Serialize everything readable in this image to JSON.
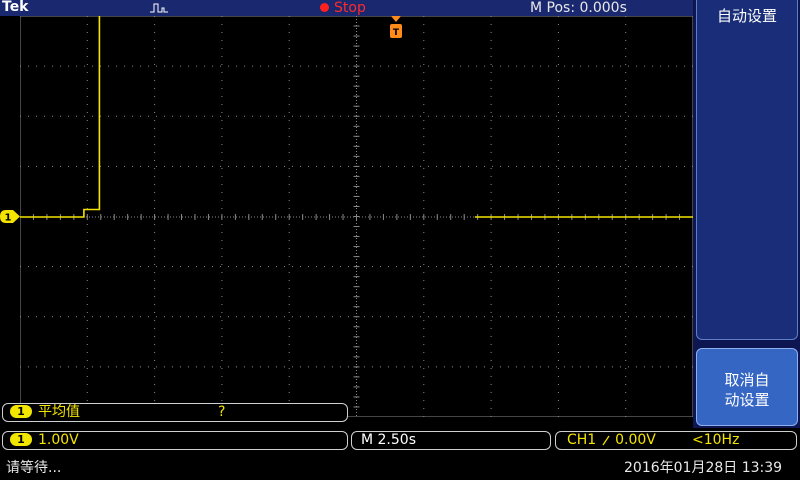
{
  "brand": "Tek",
  "acquisition": {
    "state": "Stop",
    "state_color": "#ff2020"
  },
  "horizontal_position": "M Pos: 0.000s",
  "menu": {
    "title": "自动设置",
    "undo_button_line1": "取消自",
    "undo_button_line2": "动设置"
  },
  "measurement": {
    "channel": "1",
    "label": "平均值",
    "value": "?"
  },
  "channel": {
    "number": "1",
    "scale": "1.00V",
    "color": "#f5e400"
  },
  "timebase": {
    "scale": "M 2.50s"
  },
  "trigger": {
    "source": "CH1",
    "slope_icon": "rising-edge-icon",
    "level": "0.00V",
    "frequency": "<10Hz"
  },
  "ground_marker": "1",
  "status": {
    "message": "请等待...",
    "datetime": "2016年01月28日 13:39"
  },
  "waveform": {
    "description_series": "CH1",
    "segments": [
      {
        "t_div": 0.0,
        "v_div": 0.0
      },
      {
        "t_div": 0.95,
        "v_div": 0.0
      },
      {
        "t_div": 0.95,
        "v_div": 0.15
      },
      {
        "t_div": 1.18,
        "v_div": 0.15
      },
      {
        "t_div": 1.18,
        "v_div": 4.25
      },
      {
        "t_div": 5.76,
        "v_div": 4.25
      }
    ],
    "tail": {
      "t_start_div": 6.76,
      "t_end_div": 9.0,
      "v_div": 0.0
    }
  }
}
